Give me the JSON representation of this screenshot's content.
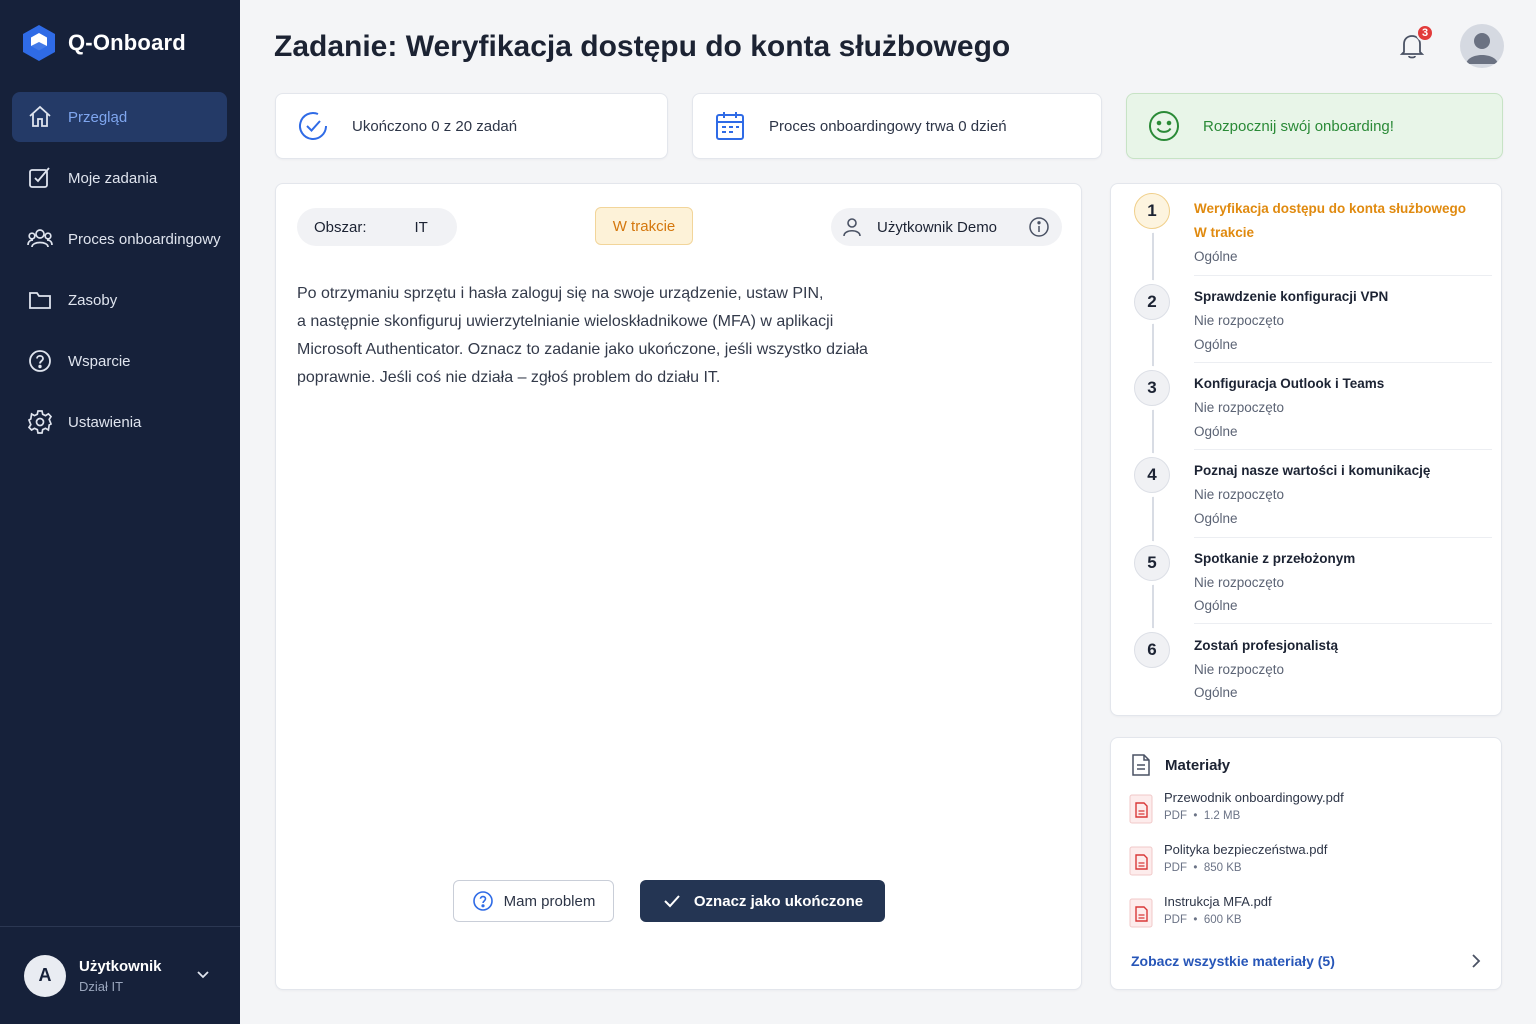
{
  "app": {
    "name": "Q-Onboard"
  },
  "sidebar": {
    "items": [
      {
        "label": "Przegląd",
        "icon": "home-icon",
        "active": true
      },
      {
        "label": "Moje zadania",
        "icon": "task-check-icon",
        "active": false
      },
      {
        "label": "Proces onboardingowy",
        "icon": "users-icon",
        "active": false
      },
      {
        "label": "Zasoby",
        "icon": "folder-icon",
        "active": false
      },
      {
        "label": "Wsparcie",
        "icon": "help-circle-icon",
        "active": false
      },
      {
        "label": "Ustawienia",
        "icon": "gear-icon",
        "active": false
      }
    ],
    "user": {
      "initial": "A",
      "name": "Użytkownik",
      "dept": "Dział IT"
    }
  },
  "header": {
    "title": "Zadanie: Weryfikacja dostępu do konta służbowego",
    "notifications": "3"
  },
  "stats": {
    "completed": "Ukończono 0 z 20 zadań",
    "duration": "Proces onboardingowy trwa 0 dzień",
    "cta": "Rozpocznij swój onboarding!"
  },
  "task": {
    "area_label": "Obszar:",
    "area_value": "IT",
    "status": "W trakcie",
    "assignee": "Użytkownik Demo",
    "description": [
      "Po otrzymaniu sprzętu i hasła zaloguj się na swoje urządzenie, ustaw PIN,",
      "a następnie skonfiguruj uwierzytelnianie wieloskładnikowe (MFA) w aplikacji",
      "Microsoft Authenticator. Oznacz to zadanie jako ukończone, jeśli wszystko działa",
      "poprawnie. Jeśli coś nie działa – zgłoś problem do działu IT."
    ],
    "problem_button": "Mam problem",
    "done_button": "Oznacz jako ukończone"
  },
  "steps": [
    {
      "num": "1",
      "title": "Weryfikacja dostępu do konta służbowego",
      "status": "W trakcie",
      "category": "Ogólne",
      "active": true
    },
    {
      "num": "2",
      "title": "Sprawdzenie konfiguracji VPN",
      "status": "Nie rozpoczęto",
      "category": "Ogólne",
      "active": false
    },
    {
      "num": "3",
      "title": "Konfiguracja Outlook i Teams",
      "status": "Nie rozpoczęto",
      "category": "Ogólne",
      "active": false
    },
    {
      "num": "4",
      "title": "Poznaj nasze wartości i komunikację",
      "status": "Nie rozpoczęto",
      "category": "Ogólne",
      "active": false
    },
    {
      "num": "5",
      "title": "Spotkanie z przełożonym",
      "status": "Nie rozpoczęto",
      "category": "Ogólne",
      "active": false
    },
    {
      "num": "6",
      "title": "Zostań profesjonalistą",
      "status": "Nie rozpoczęto",
      "category": "Ogólne",
      "active": false
    }
  ],
  "materials": {
    "title": "Materiały",
    "items": [
      {
        "name": "Przewodnik onboardingowy.pdf",
        "type": "PDF",
        "size": "1.2 MB"
      },
      {
        "name": "Polityka bezpieczeństwa.pdf",
        "type": "PDF",
        "size": "850 KB"
      },
      {
        "name": "Instrukcja MFA.pdf",
        "type": "PDF",
        "size": "600 KB"
      }
    ],
    "link": "Zobacz wszystkie materiały (5)"
  },
  "colors": {
    "sidebar": "#16213a",
    "accent": "#7fa6ef",
    "warning": "#e08a0f",
    "success": "#2a8a37",
    "primary_button": "#243553"
  }
}
